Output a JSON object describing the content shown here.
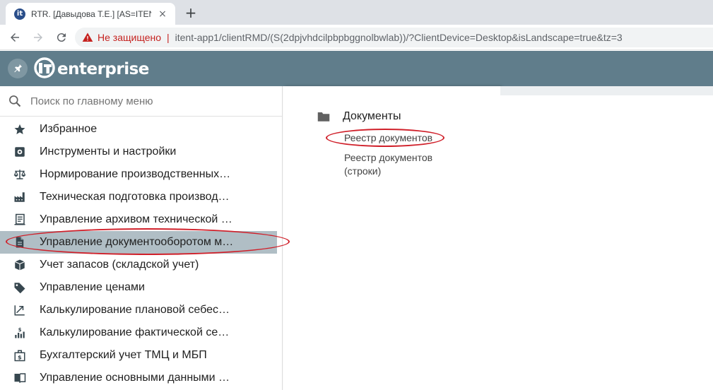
{
  "browser": {
    "tab_title": "RTR. [Давыдова Т.Е.] [AS=ITENT-",
    "tab_favicon": "it-logo-icon",
    "tab_close": "×",
    "new_tab": "+",
    "insecure_label": "Не защищено",
    "separator": "|",
    "url": "itent-app1/clientRMD/(S(2dpjvhdcilpbpbggnolbwlab))/?ClientDevice=Desktop&isLandscape=true&tz=3"
  },
  "app": {
    "brand": "enterprise",
    "header_color": "#607d8b"
  },
  "search": {
    "placeholder": "Поиск по главному меню"
  },
  "menu": [
    {
      "label": "Избранное",
      "icon": "star-icon"
    },
    {
      "label": "Инструменты и настройки",
      "icon": "settings-box-icon"
    },
    {
      "label": "Нормирование производственных…",
      "icon": "scales-icon"
    },
    {
      "label": "Техническая подготовка производ…",
      "icon": "factory-icon"
    },
    {
      "label": "Управление архивом технической …",
      "icon": "archive-doc-icon"
    },
    {
      "label": "Управление документооборотом м…",
      "icon": "document-icon",
      "selected": true
    },
    {
      "label": "Учет запасов (складской учет)",
      "icon": "inventory-icon"
    },
    {
      "label": "Управление ценами",
      "icon": "price-tag-icon"
    },
    {
      "label": "Калькулирование плановой себес…",
      "icon": "trending-up-icon"
    },
    {
      "label": "Калькулирование фактической се…",
      "icon": "cost-chart-icon"
    },
    {
      "label": "Бухгалтерский учет ТМЦ и МБП",
      "icon": "accounting-icon"
    },
    {
      "label": "Управление основными данными …",
      "icon": "book-icon"
    }
  ],
  "submenu": {
    "group_title": "Документы",
    "links": [
      "Реестр документов",
      "Реестр документов (строки)"
    ]
  },
  "colors": {
    "selected_bg": "#b0bec5",
    "annotation": "#d0202a",
    "insecure": "#c5221f"
  }
}
